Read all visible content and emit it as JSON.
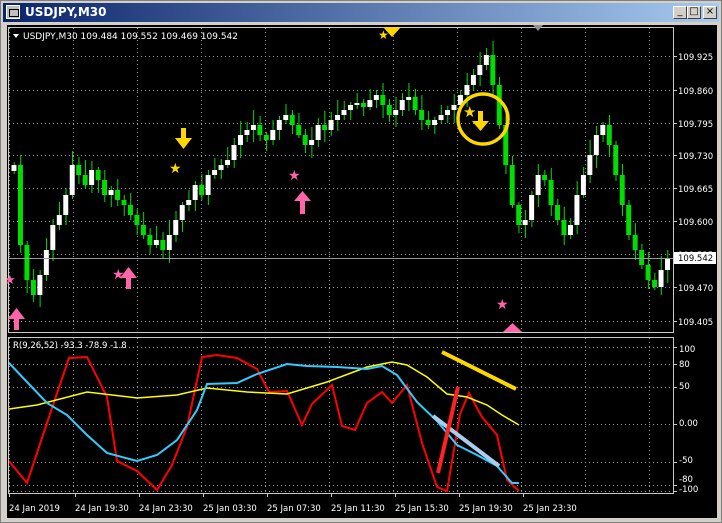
{
  "window": {
    "title": "USDJPY,M30",
    "buttons": {
      "minimize": "_",
      "restore": "□",
      "close": "×"
    }
  },
  "main_chart": {
    "header": "USDJPY,M30  109.484 109.552 109.469 109.542",
    "price_levels": [
      "109.925",
      "109.860",
      "109.795",
      "109.730",
      "109.665",
      "109.600",
      "109.535",
      "109.470",
      "109.405"
    ],
    "current_price": "109.542",
    "bull_color": "#ffffff",
    "bear_color": "#00dd00"
  },
  "indicator": {
    "label": "R(9,26,52) -93.3 -78.9 -1.8",
    "levels": [
      "100",
      "80",
      "50",
      "0.00",
      "-50",
      "-80",
      "-100"
    ],
    "series_colors": [
      "#ff0000",
      "#ffff00",
      "#33ccff"
    ]
  },
  "time_axis": [
    "24 Jan 2019",
    "24 Jan 19:30",
    "24 Jan 23:30",
    "25 Jan 03:30",
    "25 Jan 07:30",
    "25 Jan 11:30",
    "25 Jan 15:30",
    "25 Jan 19:30",
    "25 Jan 23:30"
  ]
}
